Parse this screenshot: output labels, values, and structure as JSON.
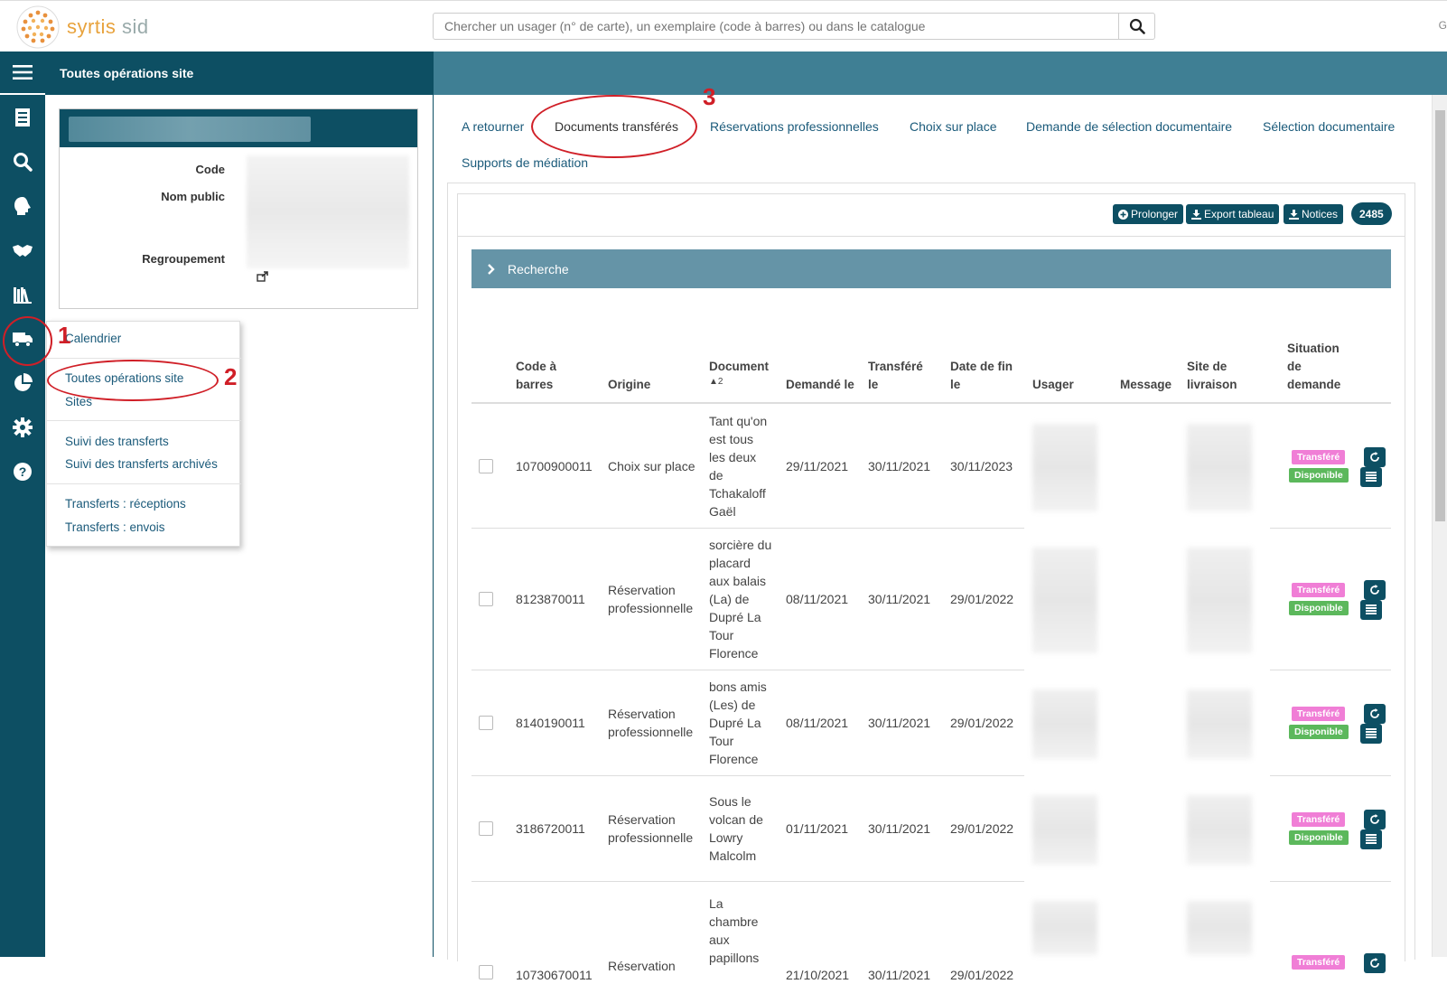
{
  "app": {
    "logo_main": "syrtis",
    "logo_sub": "sid",
    "top_right": "G"
  },
  "search": {
    "placeholder": "Chercher un usager (n° de carte), un exemplaire (code à barres) ou dans le catalogue"
  },
  "page": {
    "title": "Toutes opérations site"
  },
  "info_card": {
    "labels": [
      "Code",
      "Nom public",
      "Regroupement"
    ]
  },
  "menu": {
    "items": [
      "Calendrier",
      "Toutes opérations site",
      "Sites",
      "Suivi des transferts",
      "Suivi des transferts archivés",
      "Transferts : réceptions",
      "Transferts : envois"
    ]
  },
  "annotations": [
    "1",
    "2",
    "3"
  ],
  "tabs": [
    "A retourner",
    "Documents transférés",
    "Réservations professionnelles",
    "Choix sur place",
    "Demande de sélection documentaire",
    "Sélection documentaire",
    "Supports de médiation"
  ],
  "toolbar": {
    "prolonger": "Prolonger",
    "export": "Export tableau",
    "notices": "Notices",
    "count": "2485"
  },
  "recherche_label": "Recherche",
  "table": {
    "headers": {
      "code": [
        "Code à",
        "barres"
      ],
      "origine": "Origine",
      "document": "Document",
      "sort_indicator": "▲2",
      "demande": "Demandé le",
      "transfere": [
        "Transféré",
        "le"
      ],
      "datefin": [
        "Date de fin",
        "le"
      ],
      "usager": "Usager",
      "message": "Message",
      "site": [
        "Site de",
        "livraison"
      ],
      "situation": [
        "Situation",
        "de",
        "demande"
      ]
    },
    "badge_transfere": "Transféré",
    "badge_disponible": "Disponible",
    "rows": [
      {
        "code": "10700900011",
        "origine": [
          "Choix sur place"
        ],
        "document": [
          "Tant qu'on",
          "est tous",
          "les deux",
          "de",
          "Tchakaloff",
          "Gaël"
        ],
        "demande": "29/11/2021",
        "transfere": "30/11/2021",
        "datefin": "30/11/2023"
      },
      {
        "code": "8123870011",
        "origine": [
          "Réservation",
          "professionnelle"
        ],
        "document": [
          "sorcière du",
          "placard",
          "aux balais",
          "(La) de",
          "Dupré La",
          "Tour",
          "Florence"
        ],
        "demande": "08/11/2021",
        "transfere": "30/11/2021",
        "datefin": "29/01/2022"
      },
      {
        "code": "8140190011",
        "origine": [
          "Réservation",
          "professionnelle"
        ],
        "document": [
          "bons amis",
          "(Les) de",
          "Dupré La",
          "Tour",
          "Florence"
        ],
        "demande": "08/11/2021",
        "transfere": "30/11/2021",
        "datefin": "29/01/2022"
      },
      {
        "code": "3186720011",
        "origine": [
          "Réservation",
          "professionnelle"
        ],
        "document": [
          "Sous le",
          "volcan de",
          "Lowry",
          "Malcolm"
        ],
        "demande": "01/11/2021",
        "transfere": "30/11/2021",
        "datefin": "29/01/2022"
      },
      {
        "code": "10730670011",
        "origine": [
          "Réservation"
        ],
        "document": [
          "La",
          "chambre",
          "aux",
          "papillons"
        ],
        "demande": "21/10/2021",
        "transfere": "30/11/2021",
        "datefin": "29/01/2022"
      }
    ]
  }
}
